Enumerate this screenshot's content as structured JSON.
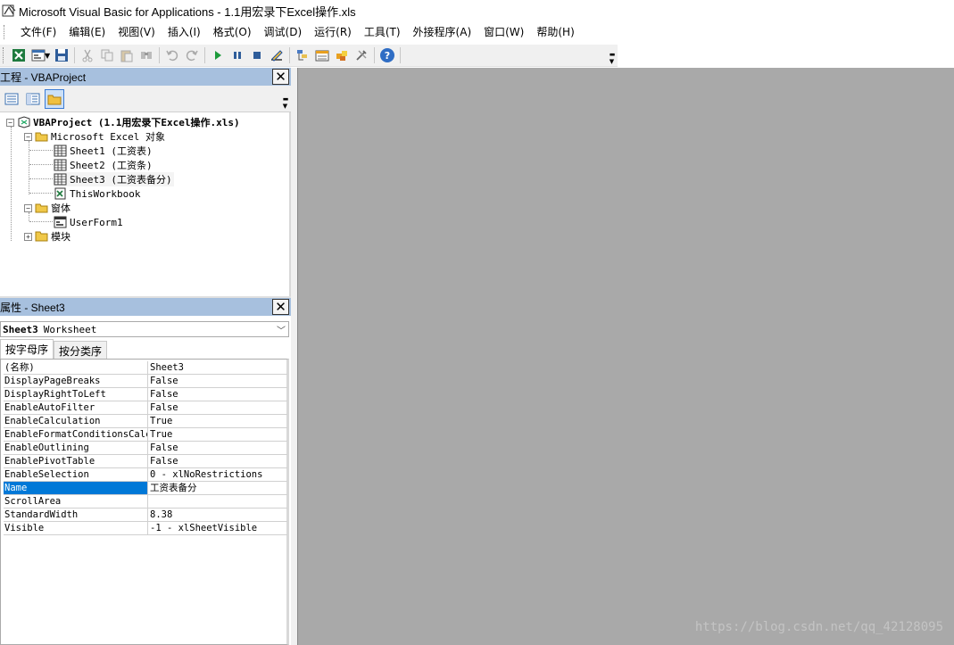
{
  "window": {
    "title": "Microsoft Visual Basic for Applications - 1.1用宏录下Excel操作.xls"
  },
  "menu": [
    "文件(F)",
    "编辑(E)",
    "视图(V)",
    "插入(I)",
    "格式(O)",
    "调试(D)",
    "运行(R)",
    "工具(T)",
    "外接程序(A)",
    "窗口(W)",
    "帮助(H)"
  ],
  "toolbar": {
    "icons": [
      "excel-icon",
      "insert-userform-icon",
      "save-icon",
      "cut-icon",
      "copy-icon",
      "paste-icon",
      "find-icon",
      "undo-icon",
      "redo-icon",
      "run-icon",
      "pause-icon",
      "reset-icon",
      "design-mode-icon",
      "project-explorer-icon",
      "properties-icon",
      "object-browser-icon",
      "toolbox-icon",
      "help-icon"
    ]
  },
  "project": {
    "title": "工程 - VBAProject",
    "root": "VBAProject (1.1用宏录下Excel操作.xls)",
    "folder_excel": "Microsoft Excel 对象",
    "sheet1": "Sheet1 (工资表)",
    "sheet2": "Sheet2 (工资条)",
    "sheet3": "Sheet3 (工资表备分)",
    "workbook": "ThisWorkbook",
    "folder_forms": "窗体",
    "userform": "UserForm1",
    "folder_modules": "模块"
  },
  "properties": {
    "title": "属性 - Sheet3",
    "object_name": "Sheet3",
    "object_type": "Worksheet",
    "tab_alpha": "按字母序",
    "tab_category": "按分类序",
    "rows": [
      {
        "k": "(名称)",
        "v": "Sheet3"
      },
      {
        "k": "DisplayPageBreaks",
        "v": "False"
      },
      {
        "k": "DisplayRightToLeft",
        "v": "False"
      },
      {
        "k": "EnableAutoFilter",
        "v": "False"
      },
      {
        "k": "EnableCalculation",
        "v": "True"
      },
      {
        "k": "EnableFormatConditionsCalculation",
        "v": "True"
      },
      {
        "k": "EnableOutlining",
        "v": "False"
      },
      {
        "k": "EnablePivotTable",
        "v": "False"
      },
      {
        "k": "EnableSelection",
        "v": "0 - xlNoRestrictions"
      },
      {
        "k": "Name",
        "v": "工资表备分"
      },
      {
        "k": "ScrollArea",
        "v": ""
      },
      {
        "k": "StandardWidth",
        "v": "8.38"
      },
      {
        "k": "Visible",
        "v": "-1 - xlSheetVisible"
      }
    ],
    "selected_row": "Name"
  },
  "watermark": "https://blog.csdn.net/qq_42128095",
  "colors": {
    "header": "#a7c0de",
    "selection": "#0078d7",
    "code_bg": "#a9a9a9"
  }
}
